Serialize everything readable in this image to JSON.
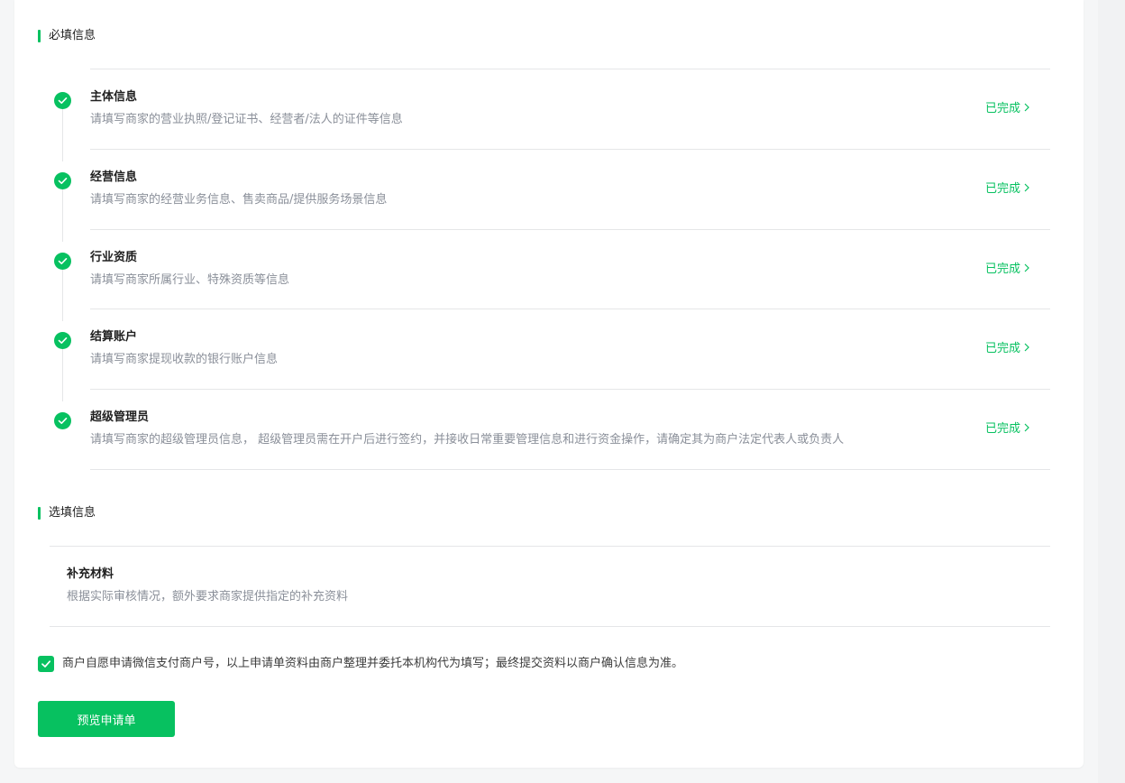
{
  "required_section": {
    "title": "必填信息"
  },
  "steps": [
    {
      "title": "主体信息",
      "desc": "请填写商家的营业执照/登记证书、经营者/法人的证件等信息",
      "status": "已完成"
    },
    {
      "title": "经营信息",
      "desc": "请填写商家的经营业务信息、售卖商品/提供服务场景信息",
      "status": "已完成"
    },
    {
      "title": "行业资质",
      "desc": "请填写商家所属行业、特殊资质等信息",
      "status": "已完成"
    },
    {
      "title": "结算账户",
      "desc": "请填写商家提现收款的银行账户信息",
      "status": "已完成"
    },
    {
      "title": "超级管理员",
      "desc": "请填写商家的超级管理员信息， 超级管理员需在开户后进行签约，并接收日常重要管理信息和进行资金操作，请确定其为商户法定代表人或负责人",
      "status": "已完成"
    }
  ],
  "optional_section": {
    "title": "选填信息",
    "item": {
      "title": "补充材料",
      "desc": "根据实际审核情况，额外要求商家提供指定的补充资料"
    }
  },
  "agreement": {
    "checked": true,
    "text": "商户自愿申请微信支付商户号，以上申请单资料由商户整理并委托本机构代为填写；最终提交资料以商户确认信息为准。"
  },
  "preview_button": {
    "label": "预览申请单"
  },
  "colors": {
    "accent": "#07c160",
    "divider": "#e5e6e8",
    "muted_text": "#8a8f99"
  }
}
